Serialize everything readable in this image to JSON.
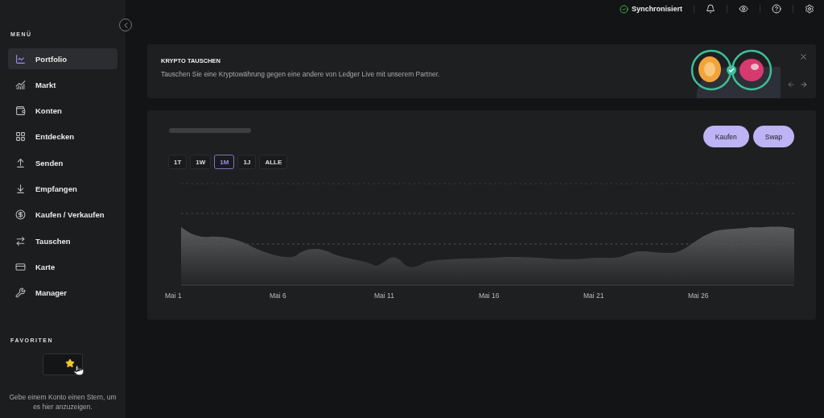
{
  "top_bar": {
    "sync_status": "Synchronisiert",
    "synced": true
  },
  "sidebar": {
    "menu_title": "MENÜ",
    "items": [
      {
        "label": "Portfolio",
        "selected": true
      },
      {
        "label": "Markt",
        "selected": false
      },
      {
        "label": "Konten",
        "selected": false
      },
      {
        "label": "Entdecken",
        "selected": false
      },
      {
        "label": "Senden",
        "selected": false
      },
      {
        "label": "Empfangen",
        "selected": false
      },
      {
        "label": "Kaufen / Verkaufen",
        "selected": false
      },
      {
        "label": "Tauschen",
        "selected": false
      },
      {
        "label": "Karte",
        "selected": false
      },
      {
        "label": "Manager",
        "selected": false
      }
    ],
    "favorites_title": "FAVORITEN",
    "favorites_hint": "Gebe einem Konto einen Stern, um es hier anzuzeigen."
  },
  "banner": {
    "title": "KRYPTO TAUSCHEN",
    "text": "Tauschen Sie eine Kryptowährung gegen eine andere von Ledger Live mit unserem Partner."
  },
  "portfolio": {
    "buttons": [
      "Kaufen",
      "Swap"
    ],
    "ranges": [
      {
        "label": "1T",
        "selected": false
      },
      {
        "label": "1W",
        "selected": false
      },
      {
        "label": "1M",
        "selected": true
      },
      {
        "label": "1J",
        "selected": false
      },
      {
        "label": "ALLE",
        "selected": false
      }
    ],
    "x_labels": [
      "Mai 1",
      "Mai 6",
      "Mai 11",
      "Mai 16",
      "Mai 21",
      "Mai 26"
    ]
  }
}
